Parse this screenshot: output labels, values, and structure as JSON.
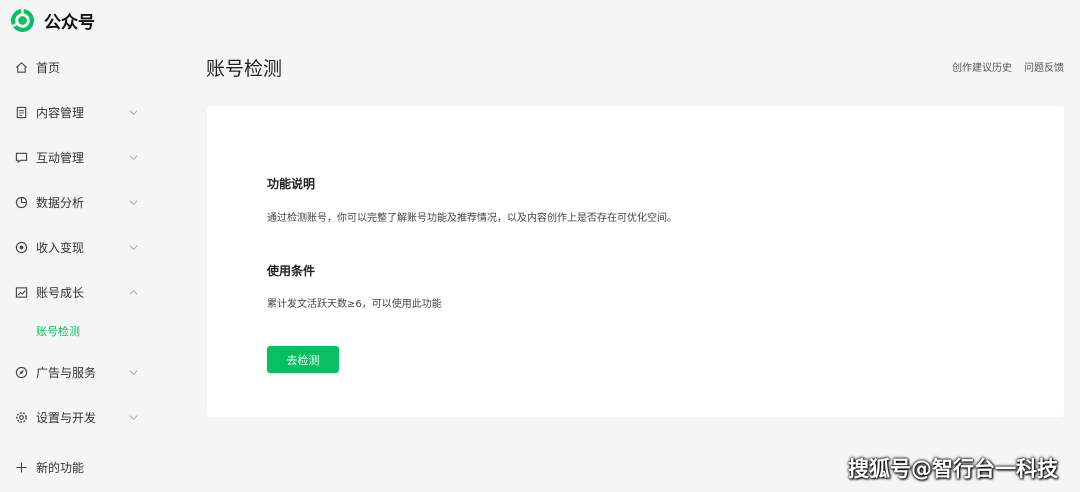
{
  "app": {
    "title": "公众号"
  },
  "sidebar": {
    "items": [
      {
        "label": "首页",
        "icon": "home-icon"
      },
      {
        "label": "内容管理",
        "icon": "document-icon"
      },
      {
        "label": "互动管理",
        "icon": "message-icon"
      },
      {
        "label": "数据分析",
        "icon": "pie-chart-icon"
      },
      {
        "label": "收入变现",
        "icon": "coin-icon"
      },
      {
        "label": "账号成长",
        "icon": "trend-icon"
      },
      {
        "label": "广告与服务",
        "icon": "compass-icon"
      },
      {
        "label": "设置与开发",
        "icon": "gear-icon"
      },
      {
        "label": "新的功能",
        "icon": "plus-icon"
      }
    ],
    "active_sub": "账号检测"
  },
  "page": {
    "title": "账号检测",
    "links": [
      "创作建议历史",
      "问题反馈"
    ]
  },
  "card": {
    "section1_title": "功能说明",
    "section1_text": "通过检测账号，你可以完整了解账号功能及推荐情况，以及内容创作上是否存在可优化空间。",
    "section2_title": "使用条件",
    "section2_text": "累计发文活跃天数≥6，可以使用此功能",
    "button_label": "去检测"
  },
  "watermark": "搜狐号@智行台一科技",
  "colors": {
    "accent": "#07c160",
    "background": "#f5f5f5",
    "card": "#ffffff"
  }
}
